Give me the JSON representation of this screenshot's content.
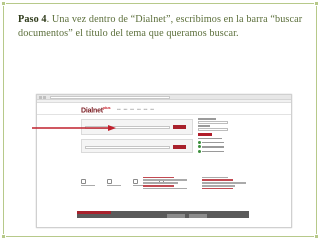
{
  "slide": {
    "step_label": "Paso 4",
    "caption_text": ". Una vez dentro de “Dialnet”, escribimos en la barra “buscar documentos” el título del tema que queramos buscar."
  },
  "colors": {
    "frame": "#b7c98a",
    "caption": "#5b6e3a",
    "brand": "#7a1c22",
    "accent_red": "#a8212c"
  },
  "screenshot": {
    "logo_text": "Dialnet",
    "logo_plus": "plus",
    "icons": [
      "browser-icon",
      "search-icon",
      "arrow-icon"
    ]
  }
}
